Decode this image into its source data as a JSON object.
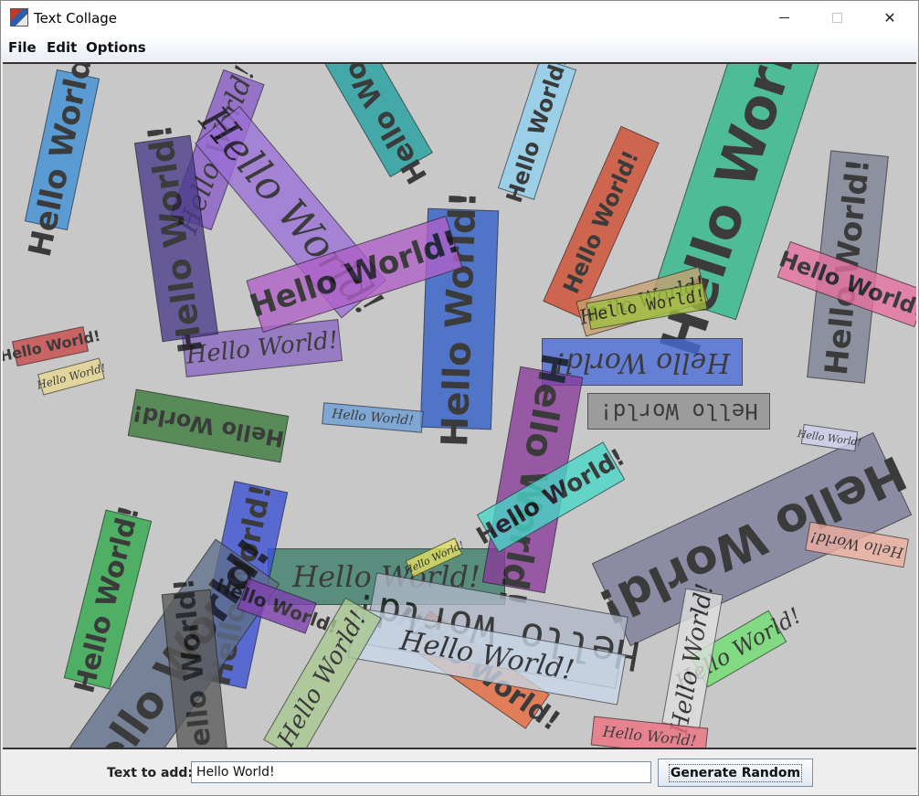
{
  "window": {
    "title": "Text Collage"
  },
  "menu": {
    "items": [
      "File",
      "Edit",
      "Options"
    ]
  },
  "controls": {
    "text_label": "Text to add:",
    "text_value": "Hello World!",
    "generate_label": "Generate Random"
  },
  "collage": {
    "stamps": [
      {
        "text": "Hello World!",
        "font": "sans",
        "color": "#3b8fd6"
      },
      {
        "text": "Hello World!",
        "font": "serif",
        "color": "#8a5cc9"
      },
      {
        "text": "Hello World!",
        "font": "sans",
        "color": "#2db98a"
      },
      {
        "text": "Hello World!",
        "font": "serif",
        "color": "#9a6fd8"
      },
      {
        "text": "Hello World!",
        "font": "sans",
        "color": "#2f5fc8"
      },
      {
        "text": "Hello World!",
        "font": "serif",
        "color": "#8a67c4"
      },
      {
        "text": "Hello World!",
        "font": "sans",
        "color": "#d04b2e"
      },
      {
        "text": "Hello World!",
        "font": "sans",
        "color": "#7d8294"
      },
      {
        "text": "Hello World!",
        "font": "sans",
        "color": "#e870a0"
      },
      {
        "text": "Hello World!",
        "font": "serif",
        "color": "#c8a070"
      },
      {
        "text": "Hello World!",
        "font": "sans",
        "color": "#2ea84a"
      },
      {
        "text": "Hello World!",
        "font": "serif",
        "color": "#3a7f6a"
      },
      {
        "text": "Hello World!",
        "font": "serif",
        "color": "#4a6bd8"
      },
      {
        "text": "Hello World!",
        "font": "sans",
        "color": "#3a4fd6"
      },
      {
        "text": "Hello World!",
        "font": "sans",
        "color": "#7a7a9a"
      },
      {
        "text": "Hello World!",
        "font": "serif",
        "color": "#e8e060"
      },
      {
        "text": "Hello World!",
        "font": "sans",
        "color": "#8a3a9a"
      },
      {
        "text": "Hello World!",
        "font": "sans",
        "color": "#5f6f8a"
      },
      {
        "text": "Hello World!",
        "font": "serif",
        "color": "#6fe06f"
      },
      {
        "text": "Hello World!",
        "font": "sans",
        "color": "#e86a3a"
      },
      {
        "text": "Hello World!",
        "font": "mono",
        "color": "#b0b8c8"
      },
      {
        "text": "Hello World!",
        "font": "sans",
        "color": "#46d8c8"
      },
      {
        "text": "Hello World!",
        "font": "serif",
        "color": "#e0e0e0"
      },
      {
        "text": "Hello World!",
        "font": "sans",
        "color": "#5a5a5a"
      },
      {
        "text": "Hello World!",
        "font": "serif",
        "color": "#f07080"
      },
      {
        "text": "Hello World!",
        "font": "sans",
        "color": "#7f3fb0"
      },
      {
        "text": "Hello World!",
        "font": "mono",
        "color": "#9fc040"
      },
      {
        "text": "Hello World!",
        "font": "serif",
        "color": "#c8d8e8"
      },
      {
        "text": "Hello World!",
        "font": "sans",
        "color": "#b060c8"
      },
      {
        "text": "Hello World!",
        "font": "serif",
        "color": "#6a9fd8"
      },
      {
        "text": "Hello World!",
        "font": "serif",
        "color": "#a8c890"
      },
      {
        "text": "Hello World!",
        "font": "sans",
        "color": "#4a3a8a"
      },
      {
        "text": "Hello World!",
        "font": "sans",
        "color": "#c84848"
      },
      {
        "text": "Hello World!",
        "font": "serif",
        "color": "#d0d0f0"
      },
      {
        "text": "Hello World!",
        "font": "sans",
        "color": "#8fd0f0"
      },
      {
        "text": "Hello World!",
        "font": "serif",
        "color": "#f0b0a0"
      },
      {
        "text": "Hello World!",
        "font": "mono",
        "color": "#909090"
      },
      {
        "text": "Hello World!",
        "font": "sans",
        "color": "#3b7a3b"
      },
      {
        "text": "Hello World!",
        "font": "serif",
        "color": "#e8d890"
      },
      {
        "text": "Hello World!",
        "font": "sans",
        "color": "#20a0a0"
      }
    ]
  }
}
